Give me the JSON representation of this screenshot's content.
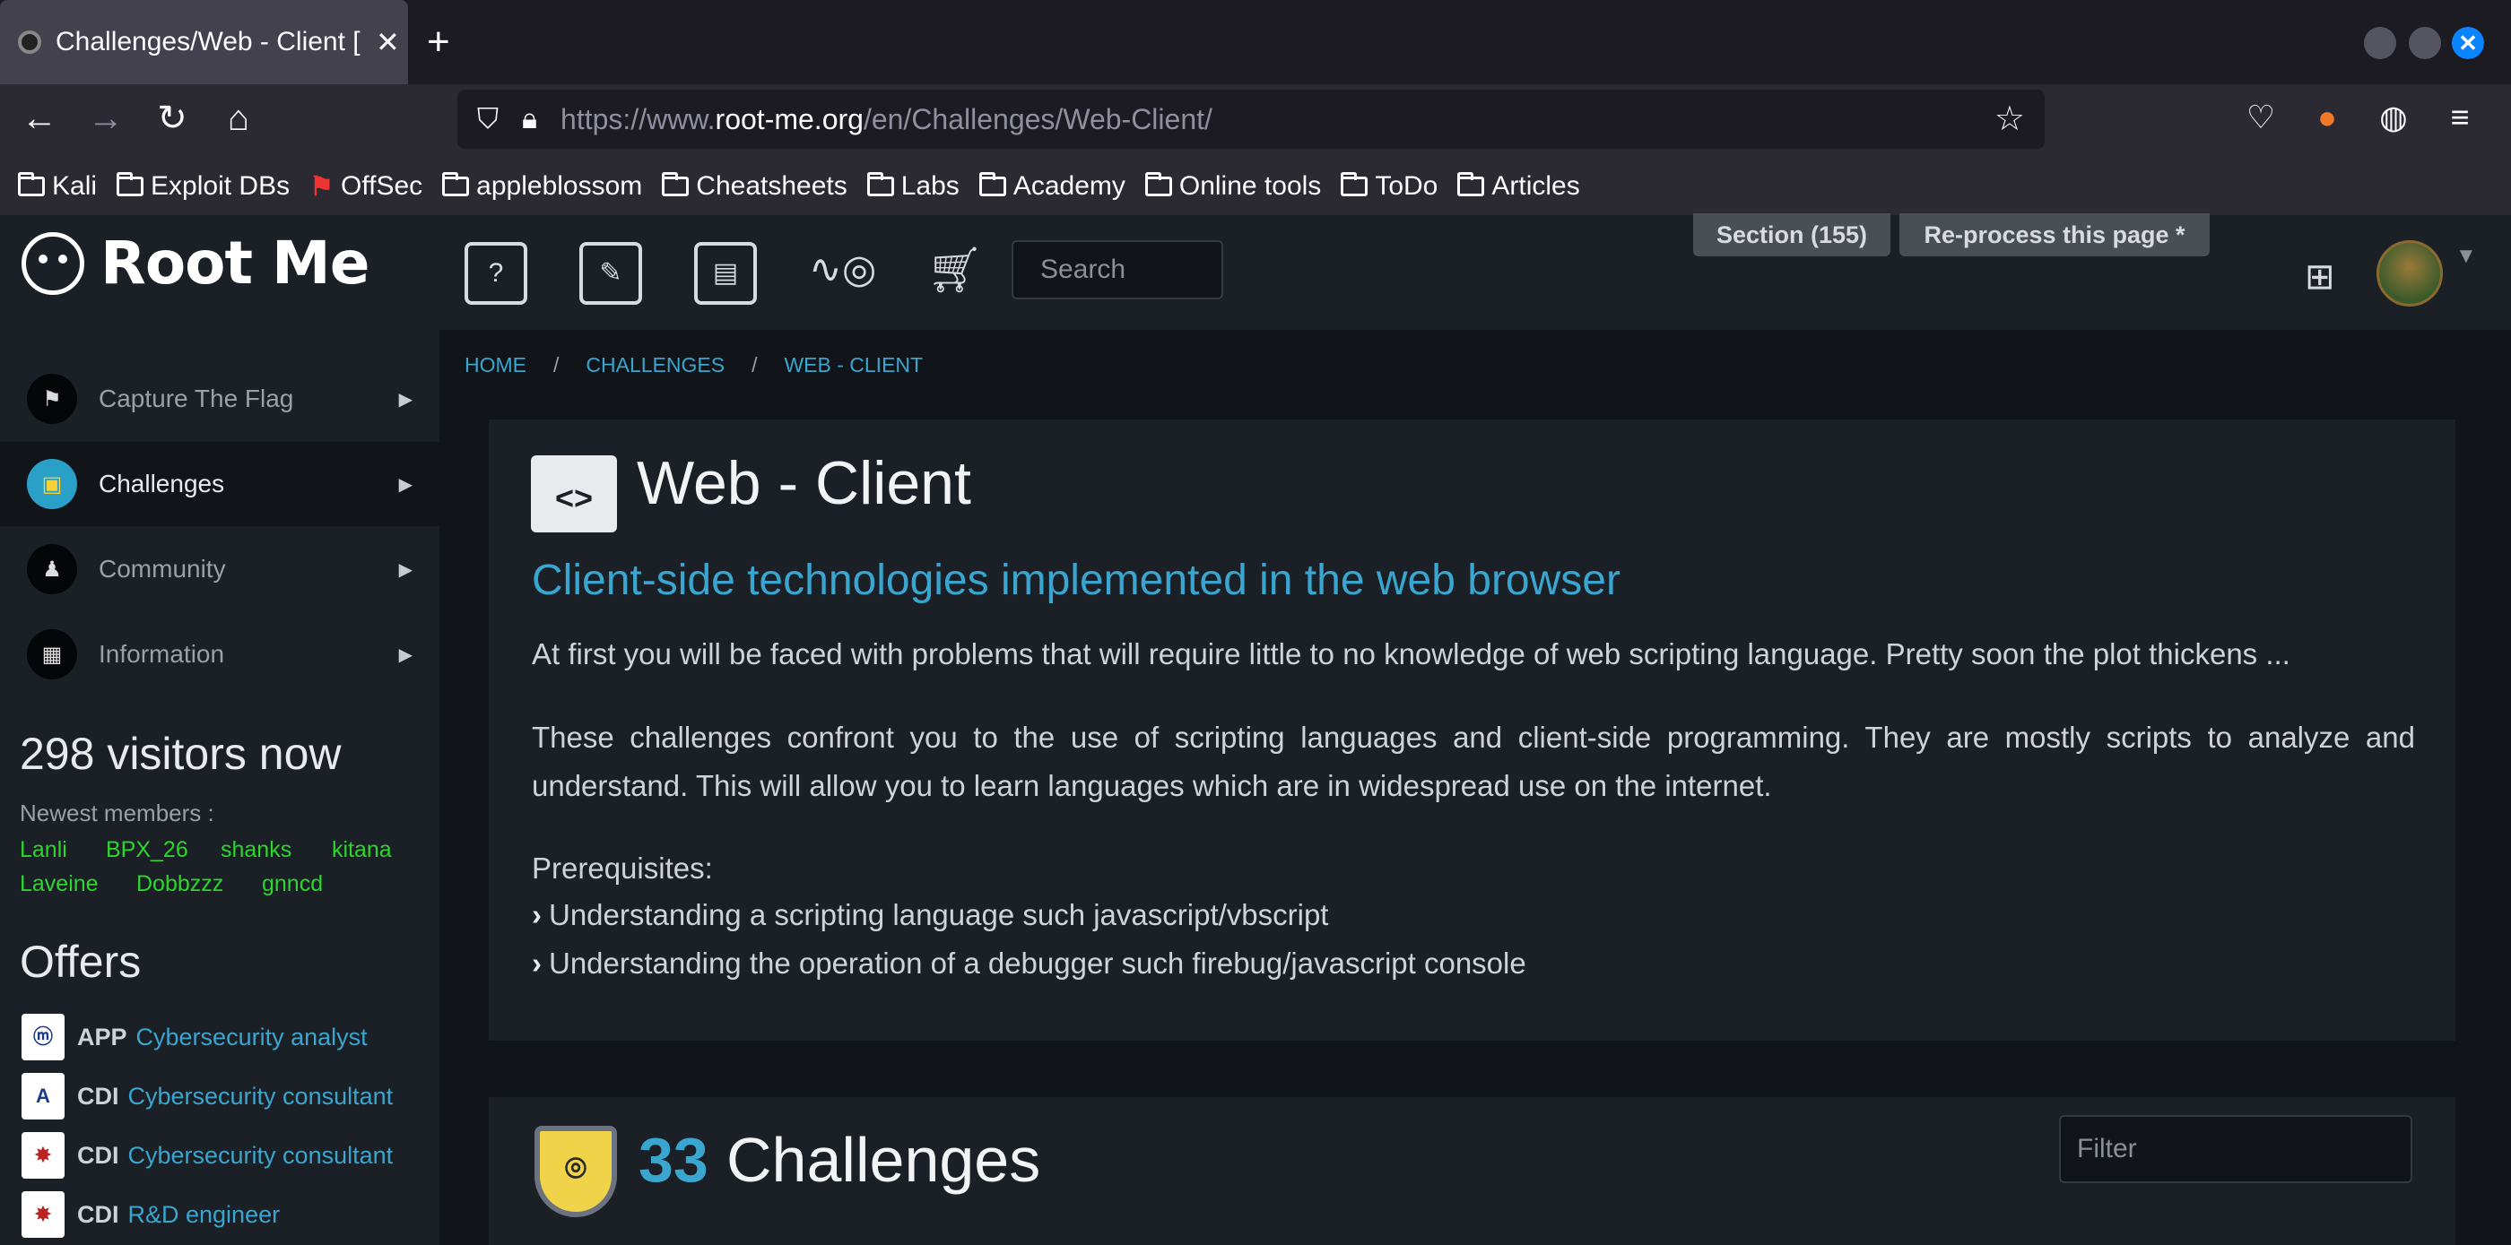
{
  "browser": {
    "tab_title": "Challenges/Web - Client [",
    "url_prefix": "https://www.",
    "url_domain": "root-me.org",
    "url_path": "/en/Challenges/Web-Client/",
    "bookmarks": [
      "Kali",
      "Exploit DBs",
      "OffSec",
      "appleblossom",
      "Cheatsheets",
      "Labs",
      "Academy",
      "Online tools",
      "ToDo",
      "Articles"
    ]
  },
  "header": {
    "logo_text": "Root Me",
    "search_placeholder": "Search",
    "section_button": "Section (155)",
    "reprocess_button": "Re-process this page *"
  },
  "sidebar": {
    "items": [
      {
        "label": "Capture The Flag",
        "icon": "flag-icon"
      },
      {
        "label": "Challenges",
        "icon": "challenge-icon"
      },
      {
        "label": "Community",
        "icon": "community-icon"
      },
      {
        "label": "Information",
        "icon": "info-book-icon"
      }
    ],
    "visitors": "298 visitors now",
    "newest_label": "Newest members :",
    "members": [
      "Lanli",
      "BPX_26",
      "shanks",
      "kitana",
      "Laveine",
      "Dobbzzz",
      "gnncd"
    ],
    "offers_title": "Offers",
    "offers": [
      {
        "type": "APP",
        "name": "Cybersecurity analyst"
      },
      {
        "type": "CDI",
        "name": "Cybersecurity consultant"
      },
      {
        "type": "CDI",
        "name": "Cybersecurity consultant"
      },
      {
        "type": "CDI",
        "name": "R&D engineer"
      }
    ]
  },
  "breadcrumb": [
    "HOME",
    "CHALLENGES",
    "WEB - CLIENT"
  ],
  "main": {
    "title": "Web - Client",
    "subtitle": "Client-side technologies implemented in the web browser",
    "para1": "At first you will be faced with problems that will require little to no knowledge of web scripting language. Pretty soon the plot thickens ...",
    "para2": "These challenges confront you to the use of scripting languages and client-side programming. They are mostly scripts to analyze and understand. This will allow you to learn languages which are in widespread use on the internet.",
    "prereq_label": "Prerequisites:",
    "prereqs": [
      "Understanding a scripting language such javascript/vbscript",
      "Understanding the operation of a debugger such firebug/javascript console"
    ],
    "challenge_count": "33",
    "challenges_label": "Challenges",
    "filter_placeholder": "Filter"
  },
  "colors": {
    "accent": "#3aa6cf",
    "member_green": "#2ed52e",
    "bg": "#111418",
    "panel": "#1b1f26"
  }
}
